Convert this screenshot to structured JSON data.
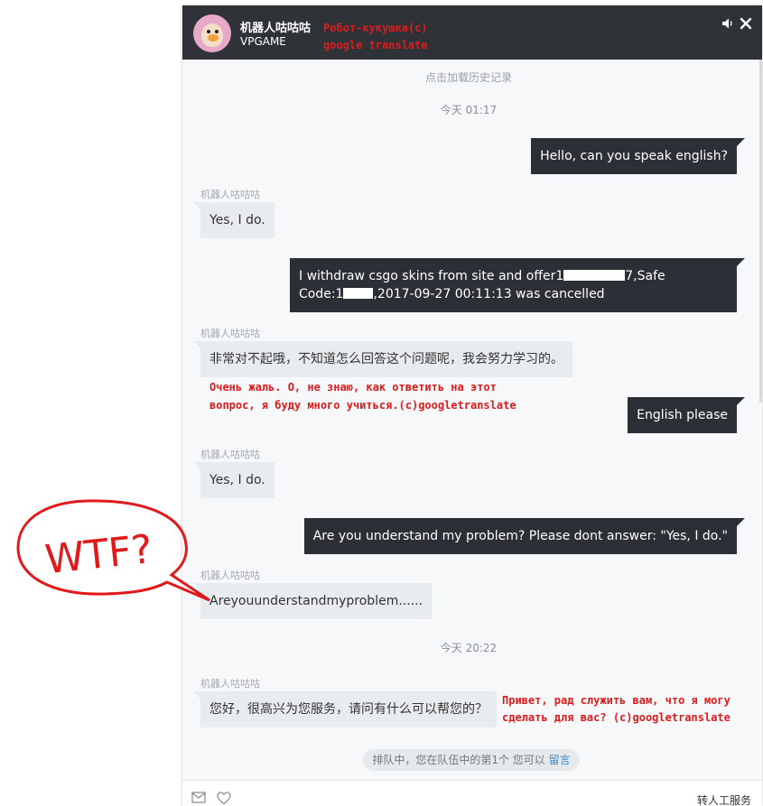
{
  "header": {
    "bot_name": "机器人咕咕咕",
    "subtitle": "VPGAME"
  },
  "chat": {
    "load_history": "点击加载历史记录",
    "timestamp_1": "今天 01:17",
    "timestamp_2": "今天 20:22",
    "sender": "机器人咕咕咕",
    "msg_out_1": "Hello, can you speak english?",
    "msg_in_1": "Yes, I do.",
    "msg_out_2_line1_pre": "I withdraw csgo skins from site and offer1",
    "msg_out_2_line1_post": "7,Safe",
    "msg_out_2_line2_pre": "Code:1",
    "msg_out_2_line2_post": ",2017-09-27 00:11:13 was cancelled",
    "msg_in_2": "非常对不起哦，不知道怎么回答这个问题呢，我会努力学习的。",
    "msg_out_3": "English please",
    "msg_in_3": "Yes, I do.",
    "msg_out_4": "Are you understand my problem? Please dont answer: \"Yes, I do.\"",
    "msg_in_4": "Areyouunderstandmyproblem......",
    "msg_in_5": "您好，很高兴为您服务，请问有什么可以帮您的？"
  },
  "queue": {
    "text": "排队中，您在队伍中的第1个 您可以",
    "link": "留言"
  },
  "footer": {
    "transfer_label": "转人工服务"
  },
  "annotations": {
    "header_note_1": "Робот-кукушка(с)",
    "header_note_2": "google translate",
    "translate_1_line1": "Очень жаль. О, не знаю, как ответить на этот",
    "translate_1_line2": "вопрос, я буду много учиться.(c)googletranslate",
    "wtf": "WTF?",
    "translate_2_line1": "Привет, рад служить вам, что я могу",
    "translate_2_line2": "сделать для вас? (c)googletranslate"
  },
  "colors": {
    "header_bg": "#2f3338",
    "bubble_out": "#2c3036",
    "bubble_in": "#e9ecef",
    "annotation_red": "#e01a1a",
    "link_blue": "#3a86c8"
  }
}
